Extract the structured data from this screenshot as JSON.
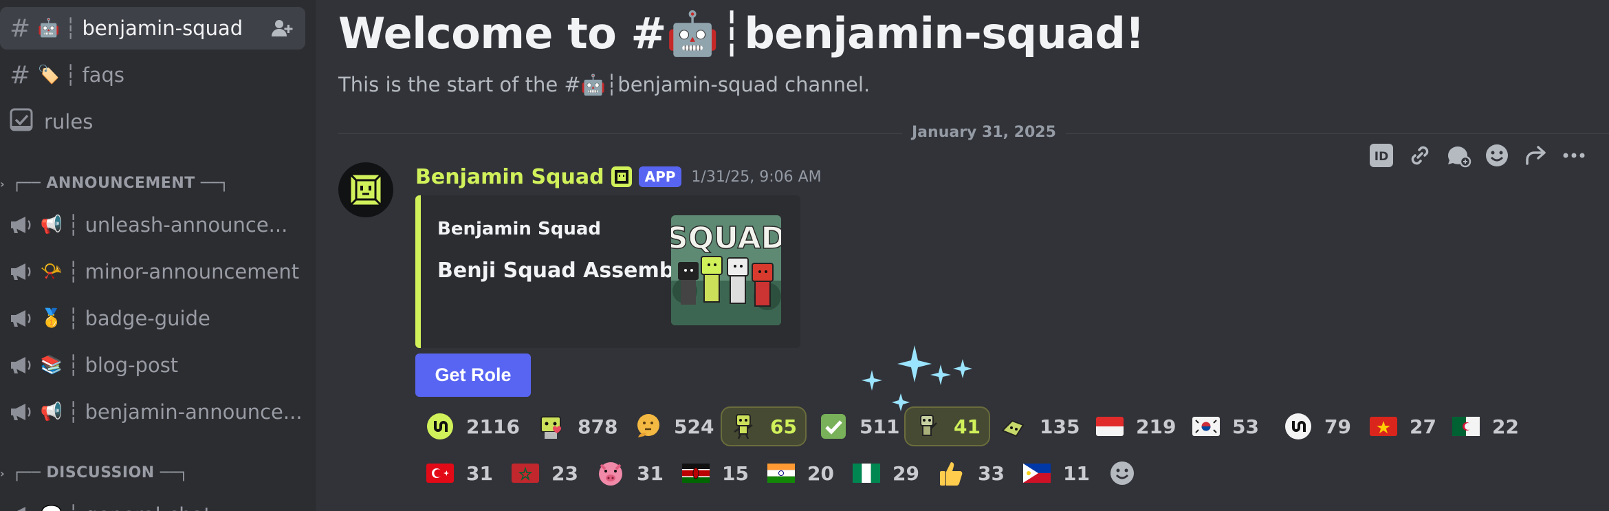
{
  "sidebar": {
    "channels": [
      {
        "emoji": "🤖",
        "name": "benjamin-squad"
      },
      {
        "emoji": "🏷️",
        "name": "faqs"
      },
      {
        "name": "rules"
      }
    ],
    "separator": "┆",
    "categories": [
      "┌── ANNOUNCEMENT ──┐",
      "┌── DISCUSSION ──┐"
    ],
    "announcements": [
      {
        "emoji": "📢",
        "name": "unleash-announce..."
      },
      {
        "emoji": "📯",
        "name": "minor-announcement"
      },
      {
        "emoji": "🥇",
        "name": "badge-guide"
      },
      {
        "emoji": "📚",
        "name": "blog-post"
      },
      {
        "emoji": "📢",
        "name": "benjamin-announce..."
      }
    ],
    "partial_channel": "general-chat"
  },
  "main": {
    "welcome": "Welcome to #🤖┆benjamin-squad!",
    "subtitle": "This is the start of the #🤖┆benjamin-squad channel.",
    "date_divider": "January 31, 2025"
  },
  "message": {
    "author": "Benjamin Squad",
    "app_tag": "APP",
    "timestamp": "1/31/25, 9:06 AM",
    "embed_author": "Benjamin Squad",
    "embed_title": "Benji Squad Assemble",
    "thumb_text": "SQUAD",
    "button": "Get Role"
  },
  "colors": {
    "accent": "#d1f15a",
    "blurple": "#5865f2",
    "bg": "#323339",
    "sidebar": "#2b2d31"
  },
  "reactions": [
    {
      "icon": "squad-logo-icon",
      "count": "2116"
    },
    {
      "icon": "robot-heart-icon",
      "count": "878"
    },
    {
      "icon": "thinking-face-icon",
      "count": "524"
    },
    {
      "icon": "green-robot-icon",
      "count": "65",
      "me": true
    },
    {
      "icon": "check-mark-icon",
      "count": "511"
    },
    {
      "icon": "robot-wave-icon",
      "count": "41",
      "me": true
    },
    {
      "icon": "robot-dance-icon",
      "count": "135"
    },
    {
      "icon": "flag-indonesia",
      "count": "219"
    },
    {
      "icon": "flag-south-korea",
      "count": "53"
    },
    {
      "icon": "squad-logo-white-icon",
      "count": "79"
    },
    {
      "icon": "flag-vietnam",
      "count": "27"
    },
    {
      "icon": "flag-algeria",
      "count": "22"
    },
    {
      "icon": "flag-turkey",
      "count": "31"
    },
    {
      "icon": "flag-morocco",
      "count": "23"
    },
    {
      "icon": "angry-pig-icon",
      "count": "31"
    },
    {
      "icon": "flag-kenya",
      "count": "15"
    },
    {
      "icon": "flag-india",
      "count": "20"
    },
    {
      "icon": "flag-nigeria",
      "count": "29"
    },
    {
      "icon": "thumbs-up-icon",
      "count": "33"
    },
    {
      "icon": "flag-philippines",
      "count": "11"
    }
  ]
}
